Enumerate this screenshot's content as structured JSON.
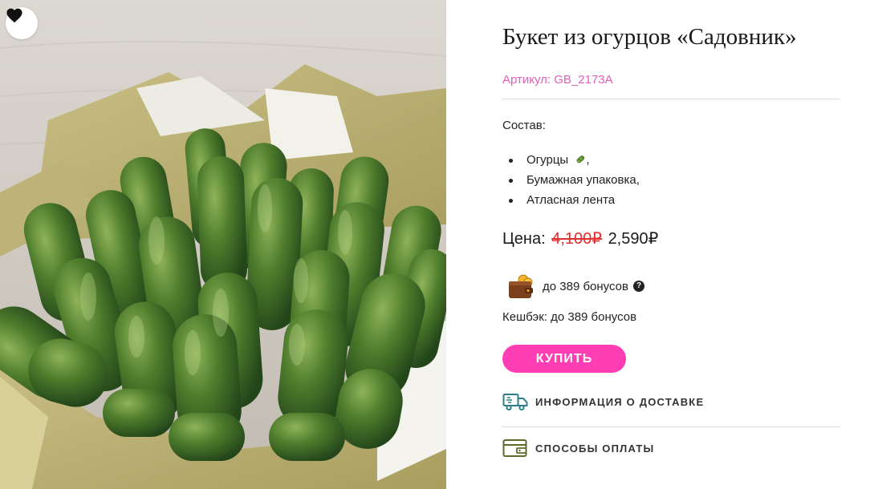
{
  "product": {
    "title": "Букет из огурцов «Садовник»",
    "sku_label": "Артикул:",
    "sku_value": "GB_2173A"
  },
  "composition": {
    "label": "Состав:",
    "items": [
      "Огурцы",
      "Бумажная упаковка,",
      "Атласная лента"
    ],
    "first_item_suffix": ","
  },
  "price": {
    "label": "Цена:",
    "old": "4,100₽",
    "new": "2,590₽"
  },
  "bonus": {
    "text": "до 389 бонусов",
    "help_symbol": "?",
    "cashback": "Кешбэк: до 389 бонусов"
  },
  "actions": {
    "buy_label": "КУПИТЬ",
    "delivery_label": "ИНФОРМАЦИЯ О ДОСТАВКЕ",
    "payment_label": "СПОСОБЫ ОПЛАТЫ"
  },
  "icons": {
    "favorite": "heart-icon",
    "cucumber_emoji": "cucumber-icon",
    "wallet": "wallet-icon",
    "help": "question-icon",
    "delivery": "truck-icon",
    "payment": "card-icon"
  },
  "colors": {
    "accent": "#ff3db4",
    "sku": "#e060b8",
    "old_price": "#e03030",
    "icon_teal": "#2a7f8a",
    "icon_green": "#5d6b2a"
  }
}
